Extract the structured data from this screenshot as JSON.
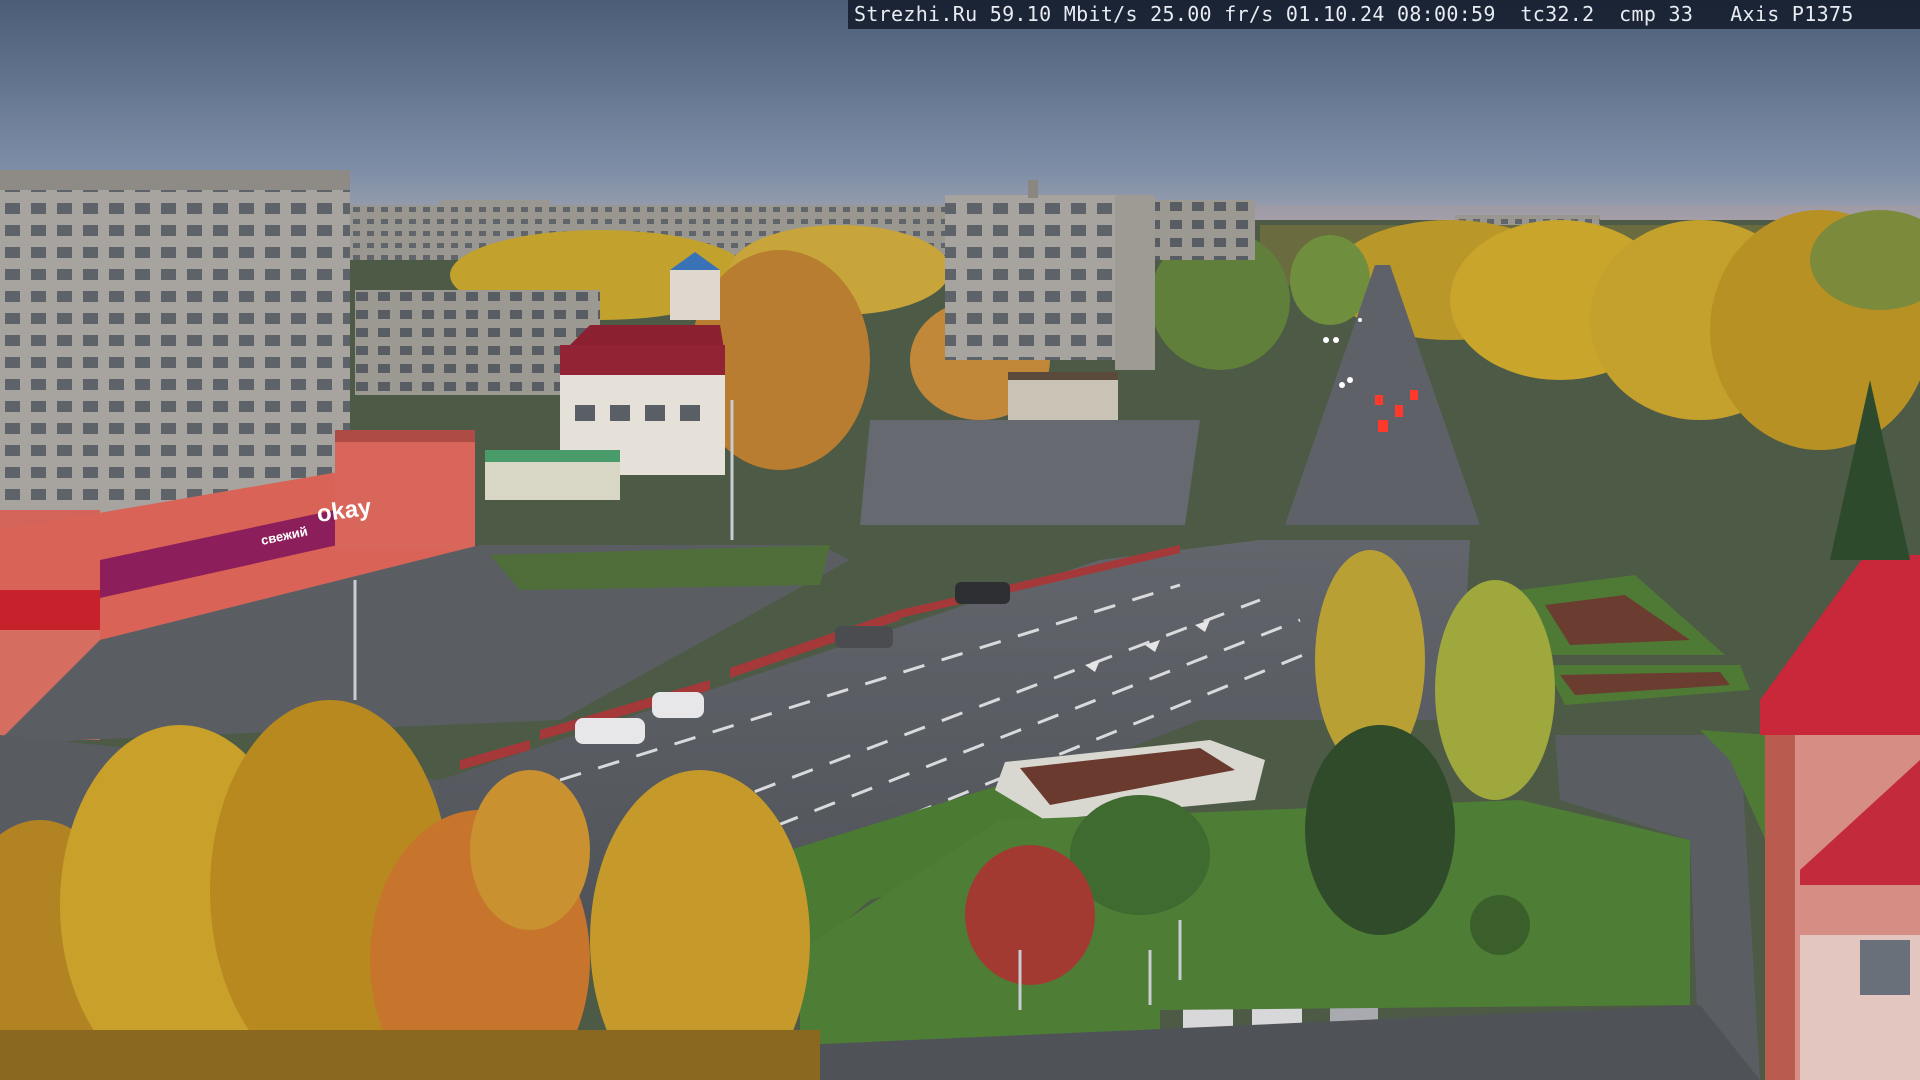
{
  "osd": {
    "text": "Strezhi.Ru 59.10 Mbit/s 25.00 fr/s 01.10.24 08:00:59  tc32.2  cmp 33   Axis P1375"
  },
  "store_sign": {
    "main": "okay",
    "secondary": "свежий"
  },
  "colors": {
    "sky_top": "#4e6078",
    "sky_bottom": "#8c9bb0",
    "autumn_yellow": "#c9a12a",
    "autumn_orange": "#c7782a",
    "grass": "#4f7a35",
    "asphalt": "#55595f",
    "store_facade": "#d15a4e",
    "store_sign_band": "#8a1f5a",
    "red_roof": "#c8283a"
  }
}
